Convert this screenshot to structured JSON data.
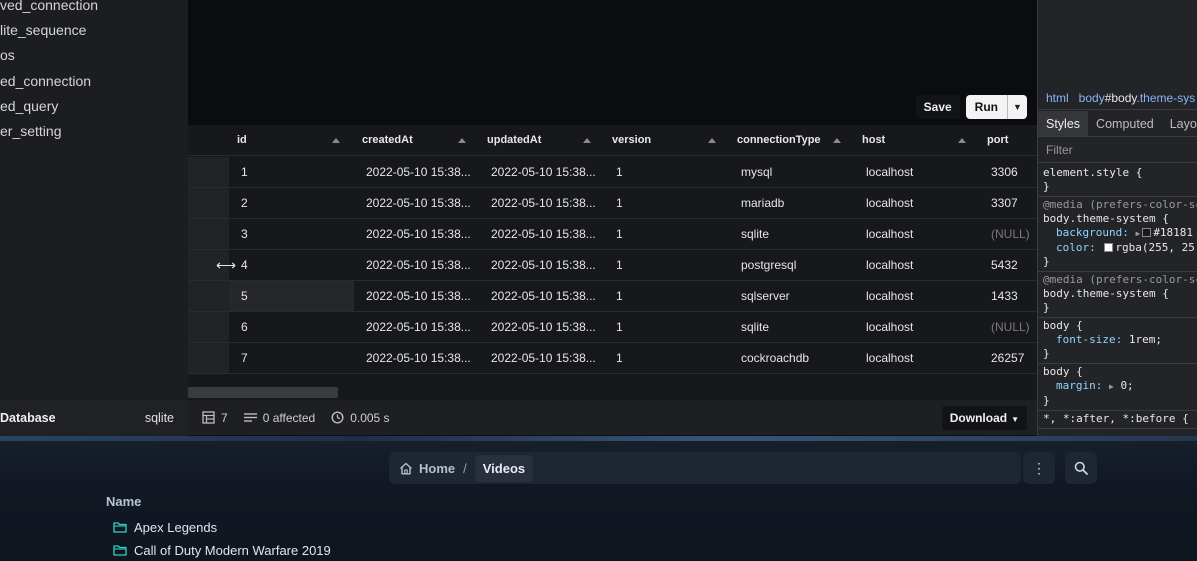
{
  "sidebar": {
    "items": [
      {
        "label": "ved_connection"
      },
      {
        "label": "lite_sequence"
      },
      {
        "label": "os"
      },
      {
        "label": "ed_connection"
      },
      {
        "label": "ed_query"
      },
      {
        "label": "er_setting"
      }
    ],
    "footer": {
      "label": "Database",
      "value": "sqlite"
    }
  },
  "toolbar": {
    "save_label": "Save",
    "run_label": "Run"
  },
  "grid": {
    "columns": [
      "id",
      "createdAt",
      "updatedAt",
      "version",
      "connectionType",
      "host",
      "port"
    ],
    "rows": [
      [
        "1",
        "2022-05-10 15:38...",
        "2022-05-10 15:38...",
        "1",
        "mysql",
        "localhost",
        "3306"
      ],
      [
        "2",
        "2022-05-10 15:38...",
        "2022-05-10 15:38...",
        "1",
        "mariadb",
        "localhost",
        "3307"
      ],
      [
        "3",
        "2022-05-10 15:38...",
        "2022-05-10 15:38...",
        "1",
        "sqlite",
        "localhost",
        "(NULL)"
      ],
      [
        "4",
        "2022-05-10 15:38...",
        "2022-05-10 15:38...",
        "1",
        "postgresql",
        "localhost",
        "5432"
      ],
      [
        "5",
        "2022-05-10 15:38...",
        "2022-05-10 15:38...",
        "1",
        "sqlserver",
        "localhost",
        "1433"
      ],
      [
        "6",
        "2022-05-10 15:38...",
        "2022-05-10 15:38...",
        "1",
        "sqlite",
        "localhost",
        "(NULL)"
      ],
      [
        "7",
        "2022-05-10 15:38...",
        "2022-05-10 15:38...",
        "1",
        "cockroachdb",
        "localhost",
        "26257"
      ]
    ],
    "null_text": "(NULL)"
  },
  "status": {
    "row_count": "7",
    "affected": "0 affected",
    "duration": "0.005 s",
    "download_label": "Download"
  },
  "devtools": {
    "breadcrumb": {
      "html": "html",
      "body_tag": "body",
      "body_id": "#body",
      "body_class": ".theme-sys"
    },
    "tabs": [
      "Styles",
      "Computed",
      "Layo"
    ],
    "filter_placeholder": "Filter",
    "rules": {
      "r1_selector": "element.style {",
      "r1_close": "}",
      "r2_media": "@media (prefers-color-sc",
      "r2_selector": "body.theme-system {",
      "r2_p1_name": "background:",
      "r2_p1_value": "#18181",
      "r2_p2_name": "color:",
      "r2_p2_value": "rgba(255, 25",
      "r2_close": "}",
      "r3_media": "@media (prefers-color-sc",
      "r3_selector": "body.theme-system {",
      "r3_close": "}",
      "r4_selector": "body {",
      "r4_p1_name": "font-size:",
      "r4_p1_value": "1rem;",
      "r4_close": "}",
      "r5_selector": "body {",
      "r5_p1_name": "margin:",
      "r5_p1_value": "0;",
      "r5_close": "}",
      "r6_selector": "*, *:after, *:before {"
    }
  },
  "files": {
    "breadcrumb": {
      "home": "Home",
      "separator": "/",
      "current": "Videos"
    },
    "column_header": "Name",
    "items": [
      {
        "name": "Apex Legends"
      },
      {
        "name": "Call of Duty  Modern Warfare 2019"
      }
    ]
  },
  "colors": {
    "folder": "#2fd3c0",
    "accent_link": "#8ab4f8"
  }
}
